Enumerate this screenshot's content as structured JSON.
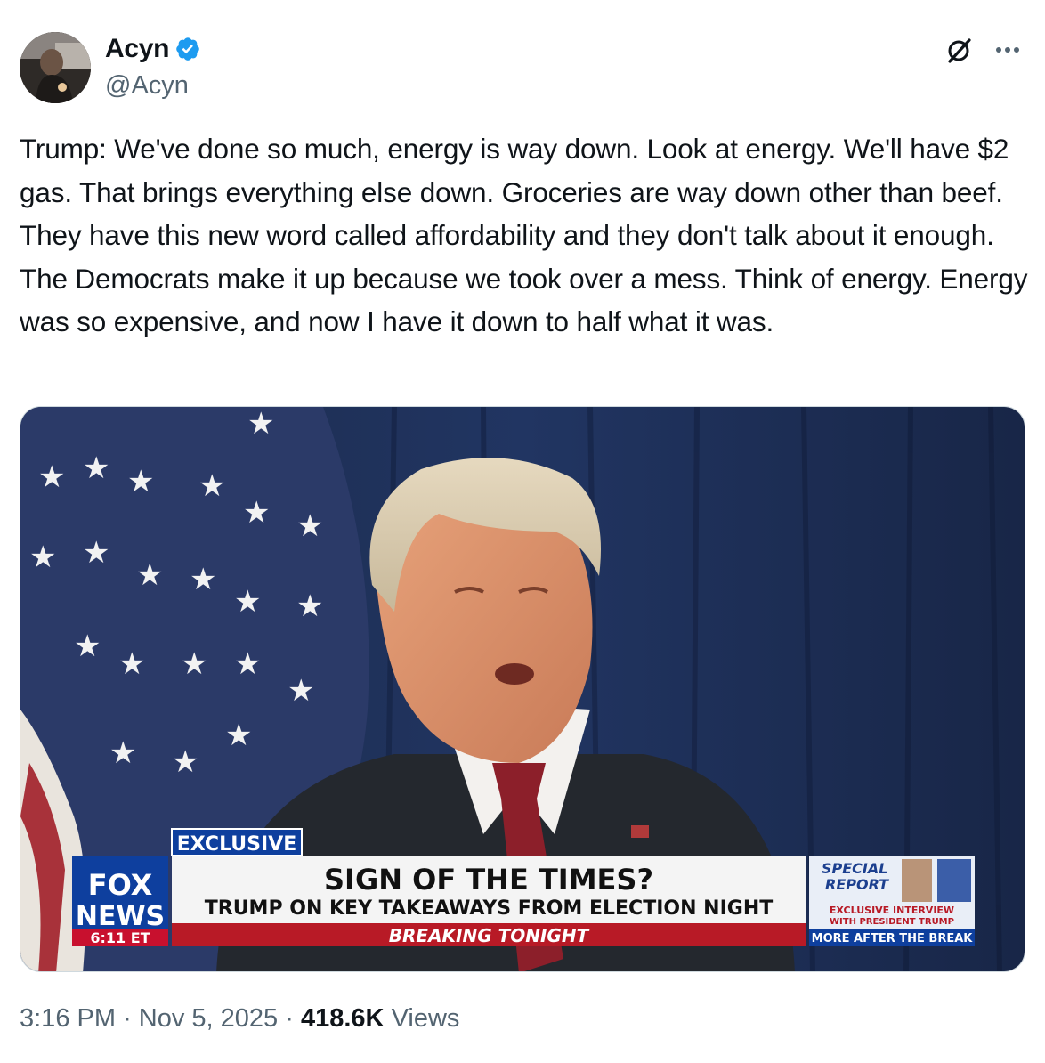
{
  "author": {
    "display_name": "Acyn",
    "handle": "@Acyn",
    "verified": true,
    "verified_color": "#1d9bf0"
  },
  "actions": {
    "grok_icon": "grok-icon",
    "more_icon": "more-icon"
  },
  "tweet": {
    "text": "Trump: We've done so much, energy is way down. Look at energy. We'll have $2 gas. That brings everything else down. Groceries are way down other than beef. They have this new word called affordability and they don't talk about it enough. The Democrats make it up because we took over a mess. Think of energy. Energy was so expensive, and now I have it down to half what it was."
  },
  "video": {
    "network_line1": "FOX",
    "network_line2": "NEWS",
    "clock": "6:11 ET",
    "tag": "EXCLUSIVE",
    "headline": "SIGN OF THE TIMES?",
    "subheadline": "TRUMP ON KEY TAKEAWAYS FROM ELECTION NIGHT",
    "breaking": "BREAKING TONIGHT",
    "promo_title_line1": "SPECIAL",
    "promo_title_line2": "REPORT",
    "promo_line1": "EXCLUSIVE INTERVIEW",
    "promo_line2": "WITH PRESIDENT TRUMP",
    "promo_footer": "MORE AFTER THE BREAK"
  },
  "meta": {
    "time": "3:16 PM",
    "separator": "·",
    "date": "Nov 5, 2025",
    "views_count": "418.6K",
    "views_label": "Views"
  }
}
